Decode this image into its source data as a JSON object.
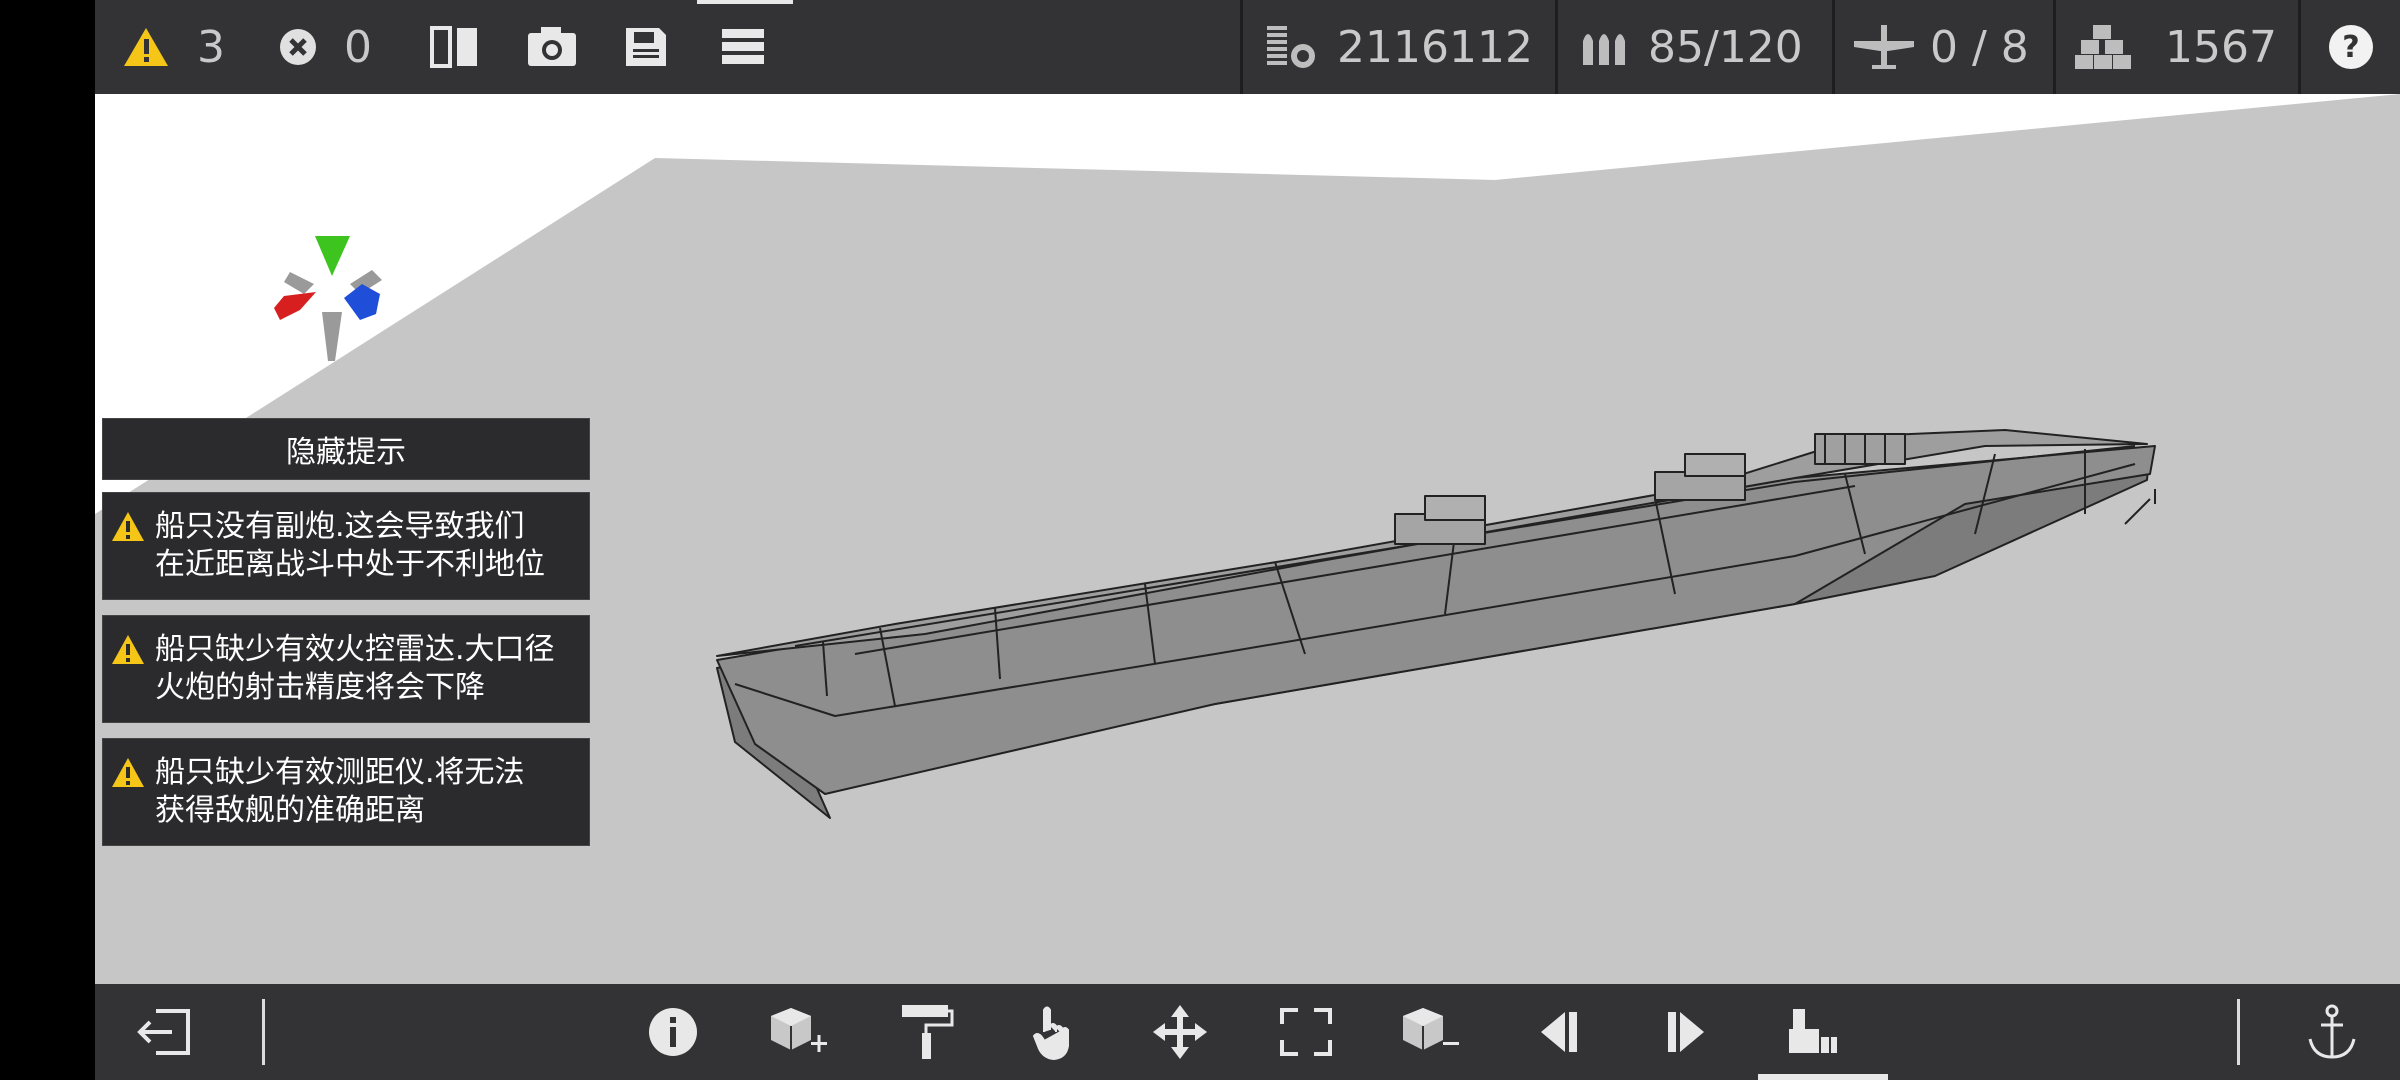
{
  "top_bar": {
    "warning_count": "3",
    "error_count": "0",
    "displacement": "2116112",
    "ammo": "85/120",
    "aircraft": "0 / 8",
    "parts": "1567"
  },
  "hints": {
    "hide_label": "隐藏提示",
    "warnings": [
      {
        "line1": "船只没有副炮.这会导致我们",
        "line2": "在近距离战斗中处于不利地位"
      },
      {
        "line1": "船只缺少有效火控雷达.大口径",
        "line2": "火炮的射击精度将会下降"
      },
      {
        "line1": "船只缺少有效测距仪.将无法",
        "line2": "获得敌舰的准确距离"
      }
    ]
  },
  "colors": {
    "bar_bg": "#333335",
    "warning_yellow": "#f5c518",
    "axis_green": "#3dc41e",
    "axis_red": "#d81f1f",
    "axis_blue": "#1f4fd8",
    "ground_gray": "#c6c6c6"
  },
  "icons": {
    "top": [
      "warning-icon",
      "error-icon",
      "mirror-icon",
      "camera-icon",
      "save-icon",
      "menu-icon",
      "displacement-icon",
      "ammo-icon",
      "aircraft-icon",
      "parts-icon",
      "help-icon"
    ],
    "bottom": [
      "exit-icon",
      "info-icon",
      "add-part-icon",
      "paint-roller-icon",
      "hand-select-icon",
      "move-icon",
      "resize-icon",
      "remove-part-icon",
      "prev-icon",
      "next-icon",
      "build-mode-icon",
      "anchor-icon"
    ]
  }
}
